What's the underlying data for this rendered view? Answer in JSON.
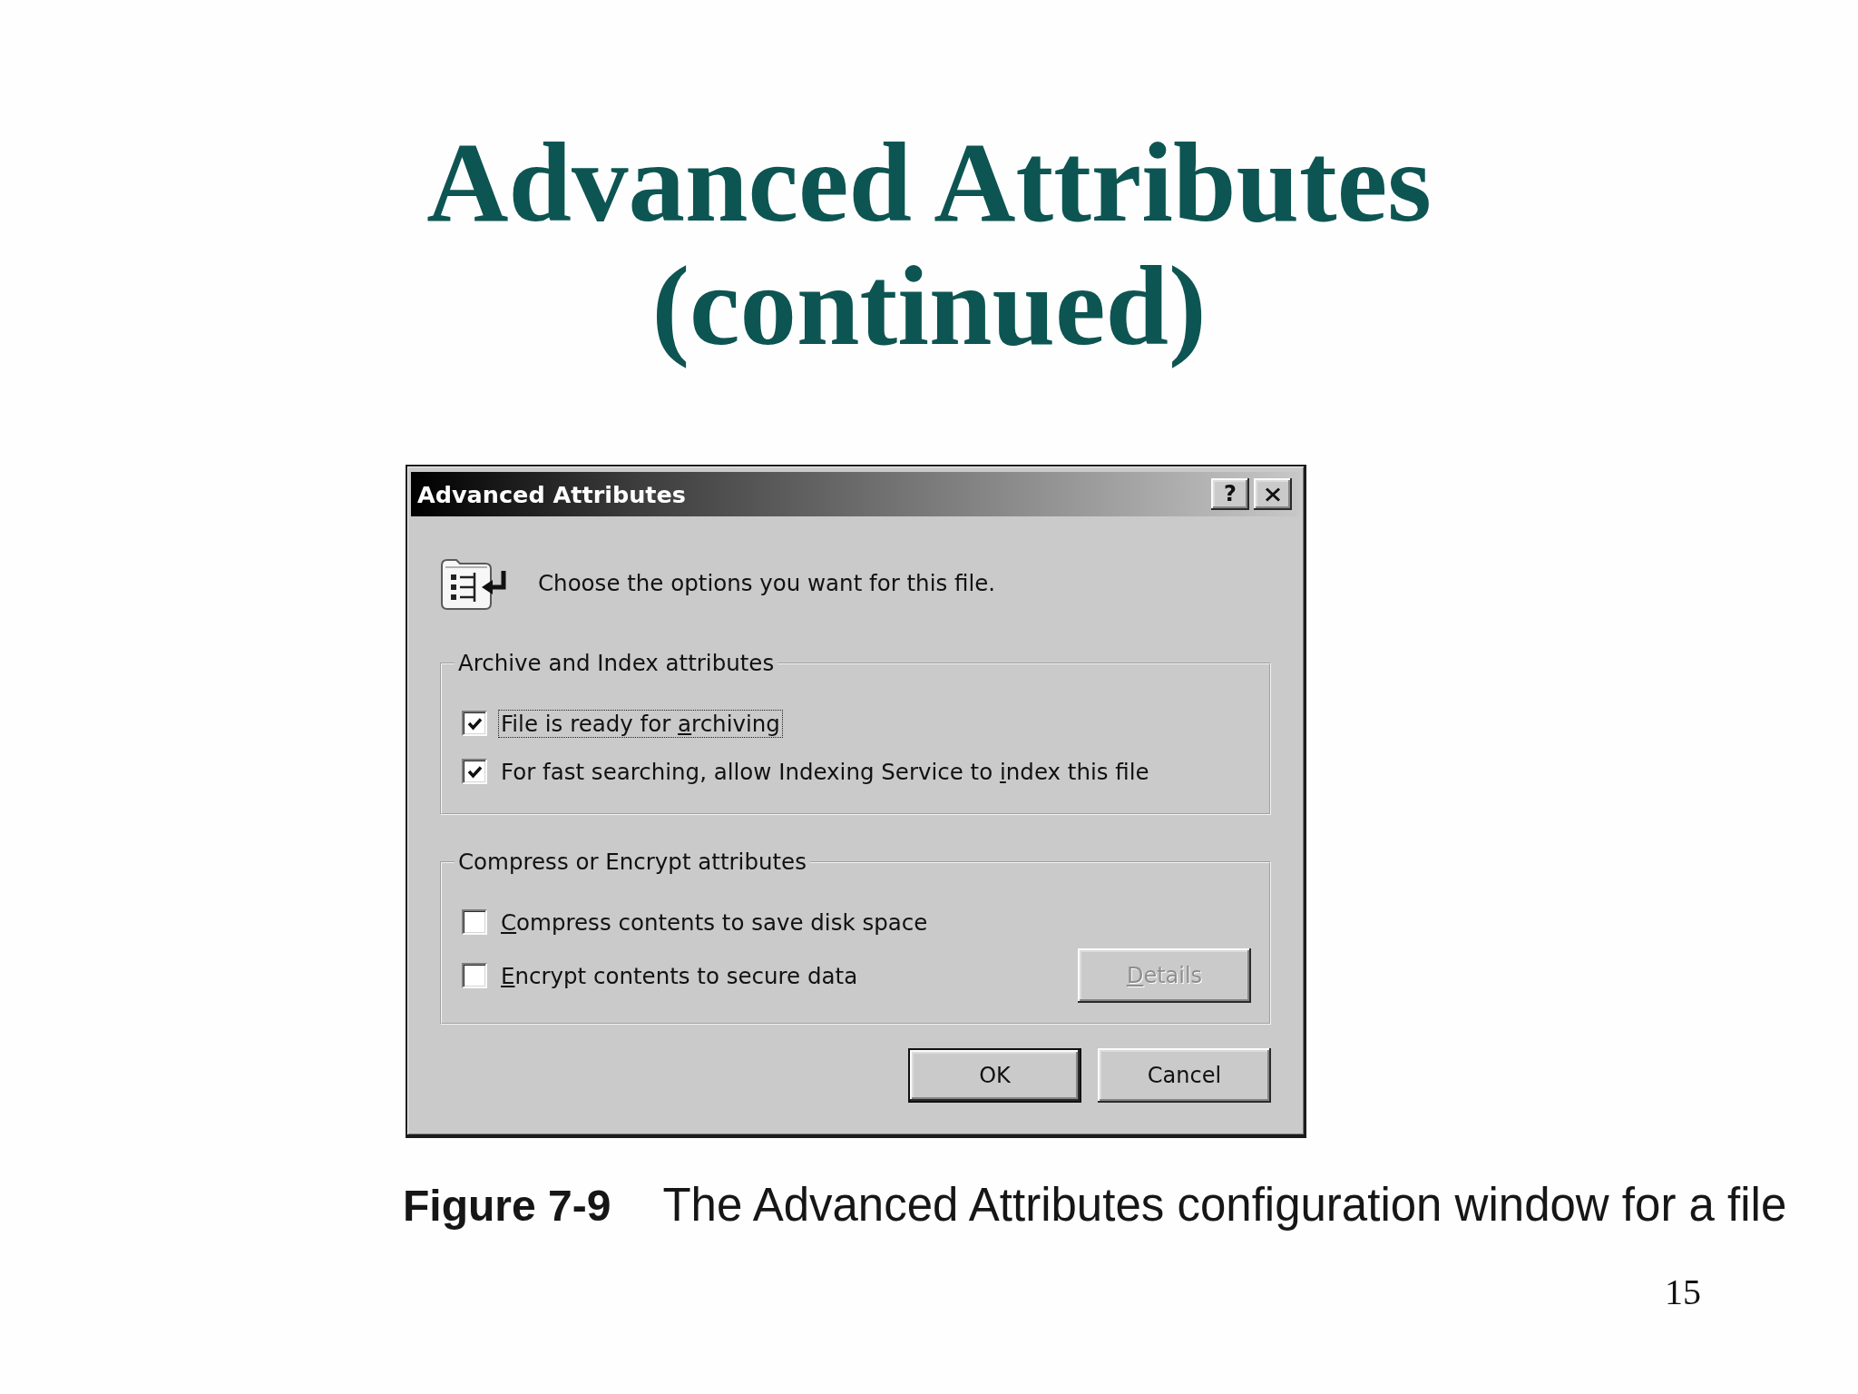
{
  "slide": {
    "title": "Advanced Attributes (continued)"
  },
  "dialog": {
    "title": "Advanced Attributes",
    "help_button": "?",
    "prompt": "Choose the options you want for this file.",
    "groups": [
      {
        "legend": "Archive and Index attributes",
        "options": [
          {
            "label": {
              "before": "File is ready for ",
              "access_key": "a",
              "after": "rchiving"
            },
            "checked": true,
            "focused": true
          },
          {
            "label": {
              "before": "For fast searching, allow Indexing Service to ",
              "access_key": "i",
              "after": "ndex this file"
            },
            "checked": true,
            "focused": false
          }
        ]
      },
      {
        "legend": "Compress or Encrypt attributes",
        "options": [
          {
            "label": {
              "access_key": "C",
              "after": "ompress contents to save disk space"
            },
            "checked": false,
            "focused": false
          },
          {
            "label": {
              "access_key": "E",
              "after": "ncrypt contents to secure data"
            },
            "checked": false,
            "focused": false
          }
        ],
        "button": {
          "label": {
            "access_key": "D",
            "after": "etails"
          },
          "disabled": true
        }
      }
    ],
    "buttons": [
      {
        "label": "OK",
        "default": true
      },
      {
        "label": "Cancel",
        "default": false
      }
    ]
  },
  "caption": {
    "label": "Figure 7-9",
    "text": "The Advanced Attributes configuration window for a file"
  },
  "page_number": "15"
}
